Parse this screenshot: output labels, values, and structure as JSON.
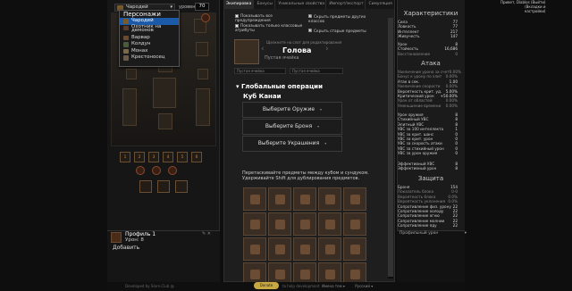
{
  "left": {
    "class_value": "Чародей",
    "level_label": "уровень",
    "level_value": "70",
    "dropdown": {
      "header": "Персонажи",
      "items": [
        {
          "label": "Чародей",
          "selected": true,
          "color": "#7a5a2a"
        },
        {
          "label": "Охотник на демонов",
          "selected": false,
          "color": "#5a3a2a"
        },
        {
          "label": "Варвар",
          "selected": false,
          "color": "#6a4a30"
        },
        {
          "label": "Колдун",
          "selected": false,
          "color": "#4a5a3a"
        },
        {
          "label": "Монах",
          "selected": false,
          "color": "#7a6a4a"
        },
        {
          "label": "Крестоносец",
          "selected": false,
          "color": "#6a5a4a"
        }
      ]
    },
    "gem_slots": [
      "1",
      "2",
      "3",
      "4",
      "5",
      "6"
    ],
    "profile": {
      "name": "Профиль 1",
      "level": "Урон: 8",
      "add": "Добавить"
    }
  },
  "tabs": [
    "Экипировка",
    "Бонусы",
    "Уникальные свойства",
    "Импорт/экспорт",
    "Симуляция"
  ],
  "options": {
    "show_all_items": "Показывать все предупреждения",
    "hide_items_other_classes": "Скрыть предметы других классов",
    "show_only_class_items": "Показывать только классовые атрибуты",
    "hide_old_items": "Скрыть старые предметы"
  },
  "slot": {
    "save_hint": "Щелкните на слот для редактирования",
    "title": "Голова",
    "empty": "Пустая ячейка",
    "select_left": "Пустая ячейка",
    "select_right": "Пустая ячейка"
  },
  "global_ops": "Глобальные операции",
  "cube": {
    "title": "Куб Канаи",
    "weapon": "Выберите Оружие",
    "armor": "Выберите Броня",
    "jewelry": "Выберите Украшения",
    "hint": "Перетаскивайте предметы между кубом и сундуком. Удерживайте Shift для дублирования предметов."
  },
  "stats": {
    "title": "Характеристики",
    "primary": [
      [
        "Сила",
        "77"
      ],
      [
        "Ловкость",
        "77"
      ],
      [
        "Интеллект",
        "217"
      ],
      [
        "Живучесть",
        "147"
      ]
    ],
    "secondary": [
      [
        "Урон",
        "8"
      ],
      [
        "Стойкость",
        "16,686"
      ],
      [
        "Восстановление",
        "0"
      ]
    ],
    "attack_title": "Атака",
    "attack": [
      [
        "Увеличение урона за счет",
        "0.00%"
      ],
      [
        "Бонус к урону по элит",
        "0.00%"
      ],
      [
        "Атак в сек.",
        "1.00"
      ],
      [
        "Увеличение скорости",
        "0.00%"
      ],
      [
        "Вероятность крит. уд.",
        "5.00%"
      ],
      [
        "Критический урон",
        "+50.00%"
      ],
      [
        "Урон от областей",
        "0.00%"
      ],
      [
        "Уменьшение времени",
        "0.00%"
      ]
    ],
    "dps": [
      [
        "Урон оружия",
        "8"
      ],
      [
        "Стихийный УВС",
        "8"
      ],
      [
        "Элитный УВС",
        "8"
      ],
      [
        "УВС за 100 интеллекта",
        "1"
      ],
      [
        "УВС за крит. шанс",
        "0"
      ],
      [
        "УВС за крит. урон",
        "0"
      ],
      [
        "УВС за скорость атаки",
        "0"
      ],
      [
        "УВС за стихийный урон",
        "0"
      ],
      [
        "УВС за урон оружия",
        "0"
      ]
    ],
    "effective": [
      [
        "Эффективный УВС",
        "8"
      ],
      [
        "Эффективный урон",
        "8"
      ]
    ],
    "defense_title": "Защита",
    "defense": [
      [
        "Броня",
        "154"
      ],
      [
        "Показатель блока",
        "0-0"
      ],
      [
        "Вероятность блока",
        "0.0%"
      ],
      [
        "Вероятность уклонения",
        "0.0%"
      ],
      [
        "Сопротивление физ. урону",
        "22"
      ],
      [
        "Сопротивление холоду",
        "22"
      ],
      [
        "Сопротивление огню",
        "22"
      ],
      [
        "Сопротивление молнии",
        "22"
      ],
      [
        "Сопротивление яду",
        "22"
      ]
    ],
    "profile_loot": "Профильный урон"
  },
  "top_right": {
    "line1": "Привет, Diablos (Выйти)",
    "line2": "(Вкладки и",
    "line3": "настройки)"
  },
  "footer": {
    "left": "Developed by Slorn.Club @",
    "donate": "Donate",
    "middle": "to help development",
    "right1": "Имена тем ▾",
    "right2": "Русский ▾"
  }
}
